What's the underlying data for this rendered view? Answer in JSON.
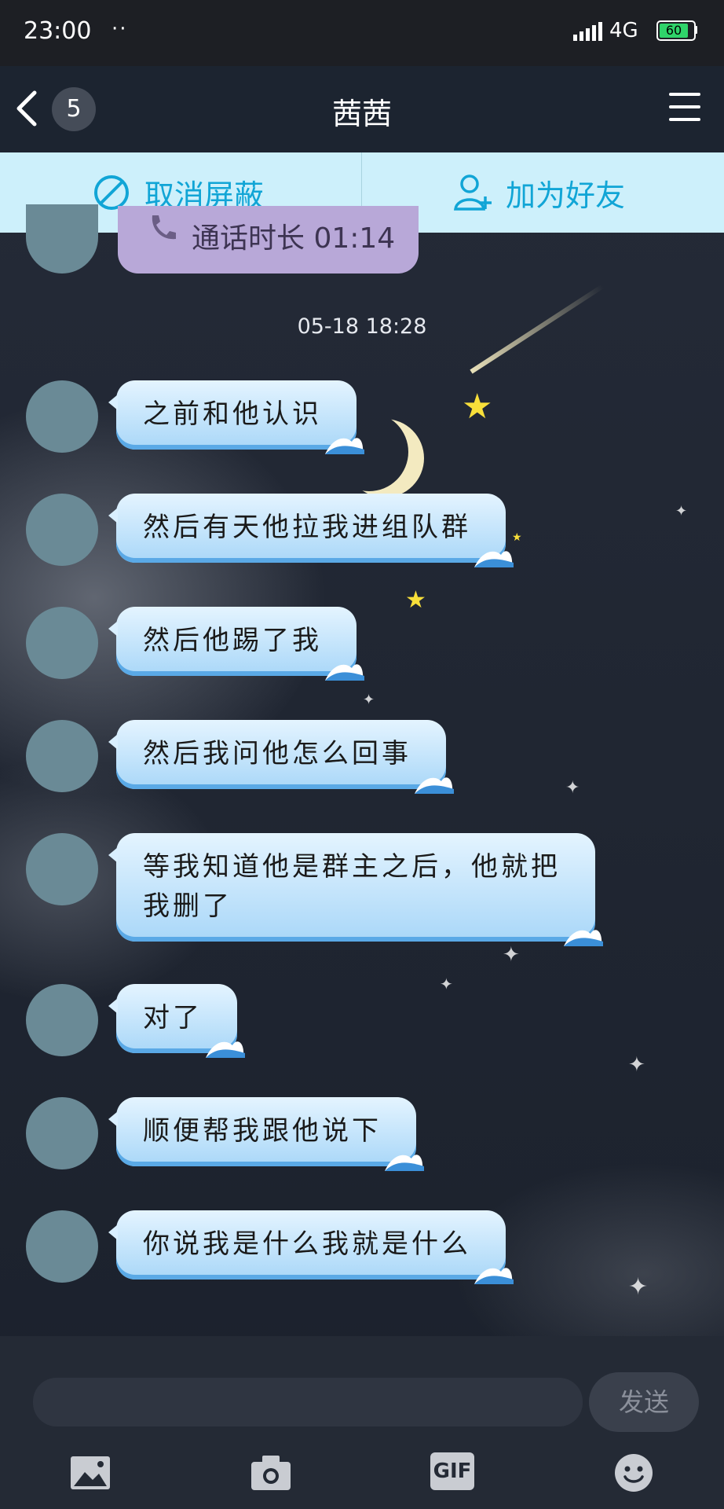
{
  "status_bar": {
    "time": "23:00",
    "dots": "··",
    "network": "4G",
    "battery": "60"
  },
  "header": {
    "back_count": "5",
    "title": "茜茜"
  },
  "actions": {
    "unblock_label": "取消屏蔽",
    "add_friend_label": "加为好友"
  },
  "call_bubble": {
    "text": "通话时长 01:14"
  },
  "timestamp": "05-18 18:28",
  "messages": [
    {
      "text": "之前和他认识"
    },
    {
      "text": "然后有天他拉我进组队群"
    },
    {
      "text": "然后他踢了我"
    },
    {
      "text": "然后我问他怎么回事"
    },
    {
      "text": "等我知道他是群主之后，他就把我删了"
    },
    {
      "text": "对了"
    },
    {
      "text": "顺便帮我跟他说下"
    },
    {
      "text": "你说我是什么我就是什么"
    }
  ],
  "composer": {
    "placeholder": "",
    "send_label": "发送",
    "gif_label": "GIF"
  },
  "colors": {
    "accent": "#11a5d6",
    "bubble_top": "#e4f4ff",
    "bubble_bottom": "#a9d7f8",
    "call_bubble": "#b8a8d8"
  }
}
